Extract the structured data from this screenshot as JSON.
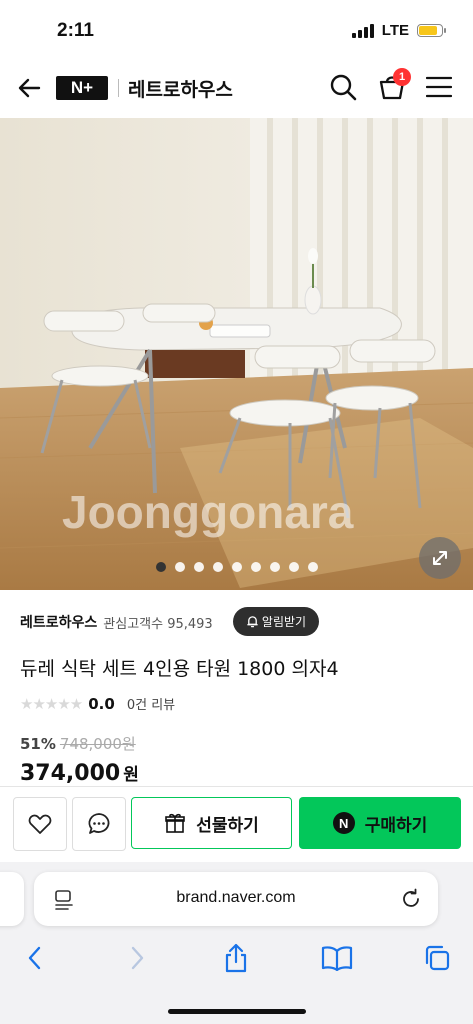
{
  "status": {
    "time": "2:11",
    "network": "LTE"
  },
  "nav": {
    "logo": "N+",
    "store_title": "레트로하우스",
    "cart_count": "1"
  },
  "gallery": {
    "watermark": "Joonggonara",
    "total_images": 9,
    "active_index": 0
  },
  "store": {
    "name": "레트로하우스",
    "follower_label": "관심고객수 95,493",
    "follow_button": "알림받기"
  },
  "product": {
    "title": "듀레 식탁 세트 4인용 타원 1800 의자4",
    "stars": "★★★★★",
    "rating": "0.0",
    "reviews": "0건 리뷰",
    "discount": "51%",
    "original_price": "748,000원",
    "final_price": "374,000",
    "currency": "원"
  },
  "actions": {
    "gift_label": "선물하기",
    "buy_label": "구매하기",
    "buy_badge": "N"
  },
  "browser": {
    "url": "brand.naver.com"
  },
  "colors": {
    "brand_green": "#03c75a",
    "badge_red": "#ff3333",
    "dark_button": "#2e2e2e",
    "ios_blue": "#1a73e8"
  },
  "icons": [
    "back-arrow-icon",
    "search-icon",
    "cart-icon",
    "menu-icon",
    "expand-icon",
    "bell-icon",
    "heart-icon",
    "chat-icon",
    "gift-icon",
    "reader-icon",
    "reload-icon",
    "chevron-left-icon",
    "chevron-right-icon",
    "share-icon",
    "bookmarks-icon",
    "tabs-icon"
  ]
}
